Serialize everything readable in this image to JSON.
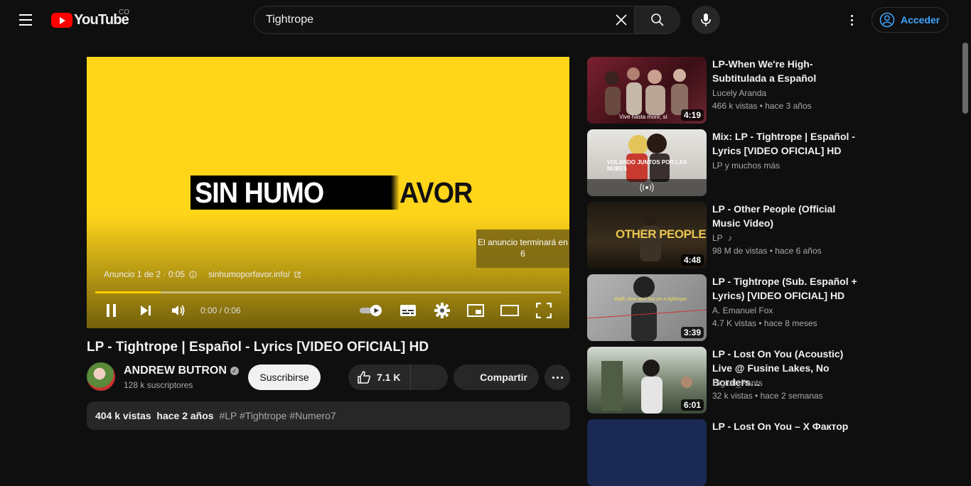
{
  "header": {
    "logo_text": "YouTube",
    "country_code": "CO",
    "search_value": "Tightrope",
    "signin_label": "Acceder"
  },
  "player": {
    "banner_white": "SIN HUMO",
    "banner_dark": "AVOR",
    "ad_end_text": "El anuncio terminará en 6",
    "ad_counter": "Anuncio 1 de 2 · 0:05",
    "ad_link": "sinhumoporfavor.info/",
    "time": "0:00 / 0:06",
    "progress_fraction": 0.14,
    "accent_color": "#ffd51a"
  },
  "video": {
    "title": "LP - Tightrope | Español - Lyrics [VIDEO OFICIAL] HD",
    "channel": "ANDREW BUTRON",
    "subscribers": "128 k suscriptores",
    "subscribe_label": "Suscribirse",
    "likes": "7.1 K",
    "share_label": "Compartir",
    "views": "404 k vistas",
    "age": "hace 2 años",
    "tags": "#LP #Tightrope #Numero7"
  },
  "recommendations": [
    {
      "title": "LP-When We're High-Subtitulada a Español",
      "channel": "Lucely Aranda",
      "views": "466 k vistas",
      "age": "• hace 3 años",
      "duration": "4:19",
      "thumb_color": "#5a1f26",
      "caption": "Vive hasta morir, sí"
    },
    {
      "title": "Mix: LP - Tightrope | Español - Lyrics [VIDEO OFICIAL] HD",
      "channel": "LP y muchos más",
      "views": "",
      "age": "",
      "duration": "",
      "thumb_color": "#c9c6c2",
      "caption": "VOLANDO JUNTOS POR LAS NUBES"
    },
    {
      "title": "LP - Other People (Official Music Video)",
      "channel": "LP",
      "views": "98 M de vistas",
      "age": "• hace 6 años",
      "duration": "4:48",
      "thumb_color": "#2c2418",
      "caption": "OTHER PEOPLE"
    },
    {
      "title": "LP - Tightrope (Sub. Español + Lyrics) [VIDEO OFICIAL] HD",
      "channel": "A. Emanuel Fox",
      "views": "4.7 K vistas",
      "age": "• hace 8 meses",
      "duration": "3:39",
      "thumb_color": "#9a9a9a",
      "caption": "Walk slow and low on a tightrope"
    },
    {
      "title": "LP - Lost On You (Acoustic) Live @ Fusine Lakes, No Borders…",
      "channel": "Digital_Pants",
      "views": "32 k vistas",
      "age": "• hace 2 semanas",
      "duration": "6:01",
      "thumb_color": "#6f7a6a",
      "caption": ""
    },
    {
      "title": "LP - Lost On You – X Фактор",
      "channel": "",
      "views": "",
      "age": "",
      "duration": "",
      "thumb_color": "#1a2a55",
      "caption": ""
    }
  ]
}
